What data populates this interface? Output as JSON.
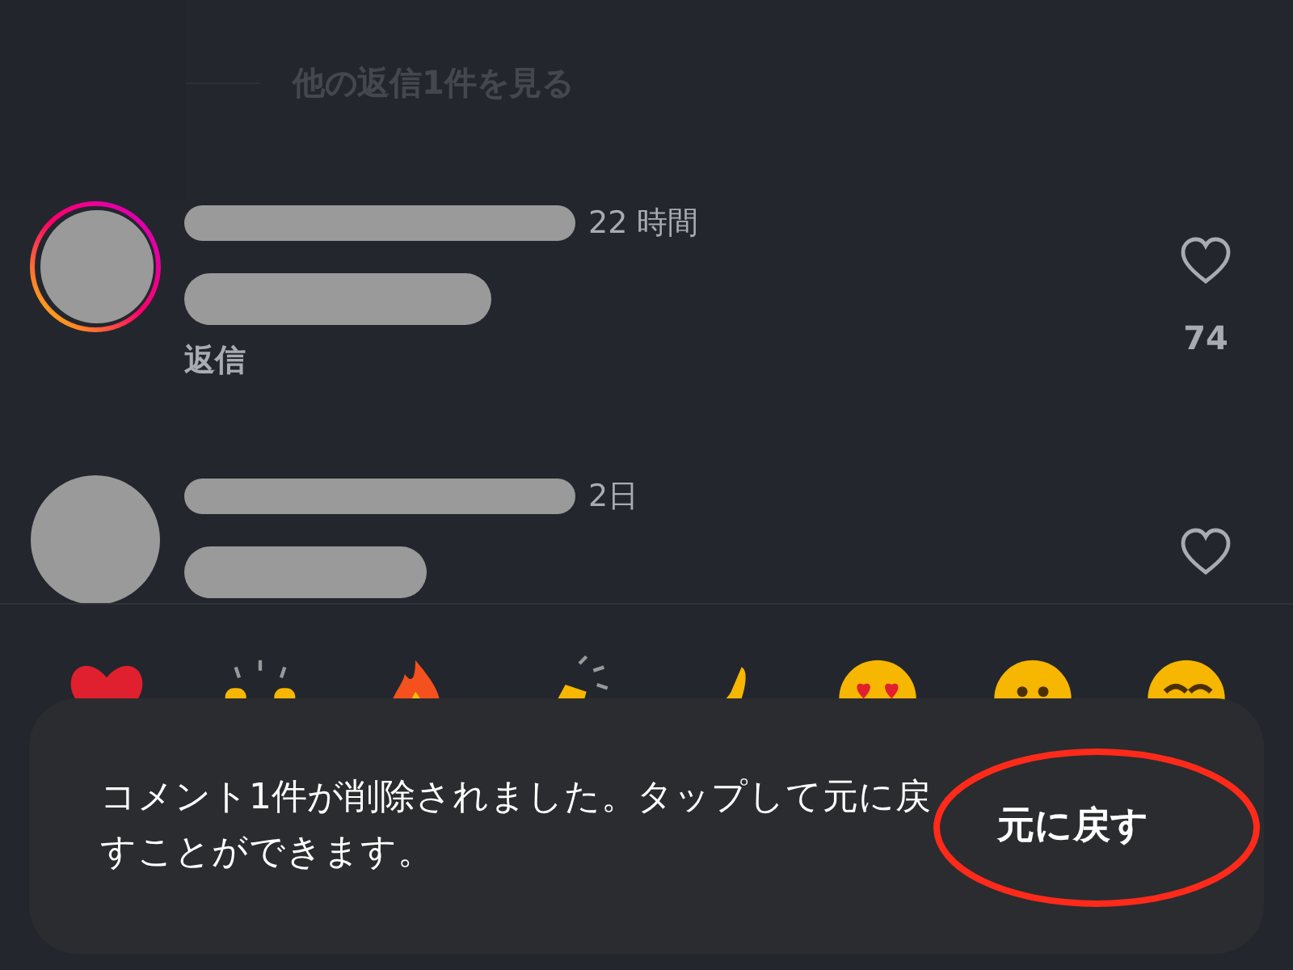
{
  "view_replies": "他の返信1件を見る",
  "comments": [
    {
      "story_ring": true,
      "time": "22 時間",
      "reply": "返信",
      "likes": "74"
    },
    {
      "story_ring": false,
      "time": "2日"
    }
  ],
  "reactions": [
    {
      "kind": "heart"
    },
    {
      "kind": "raised-hands"
    },
    {
      "kind": "fire"
    },
    {
      "kind": "clap"
    },
    {
      "kind": "hand"
    },
    {
      "kind": "heart-eyes"
    },
    {
      "kind": "neutral"
    },
    {
      "kind": "laugh"
    }
  ],
  "toast": {
    "message": "コメント1件が削除されました。タップして元に戻すことができます。",
    "action": "元に戻す",
    "highlighted": true
  }
}
